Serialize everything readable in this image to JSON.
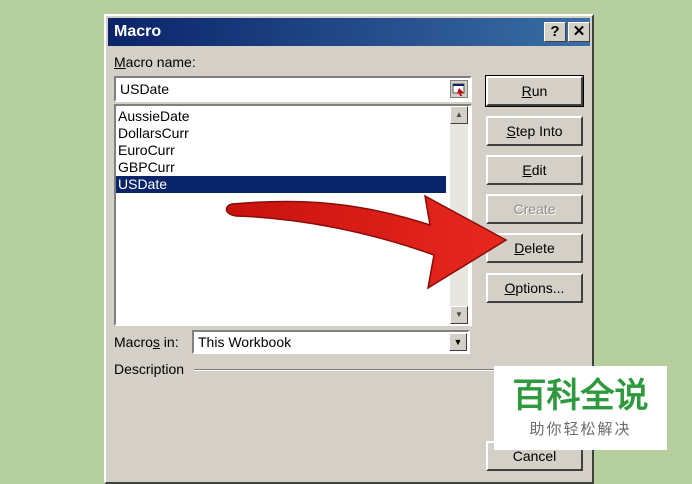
{
  "window": {
    "title": "Macro",
    "help_button": "?",
    "close_button": "✕"
  },
  "macro_name": {
    "label": "Macro name:",
    "value": "USDate"
  },
  "macro_list": {
    "items": [
      "AussieDate",
      "DollarsCurr",
      "EuroCurr",
      "GBPCurr",
      "USDate"
    ],
    "selected": "USDate"
  },
  "buttons": {
    "run": "Run",
    "step_into": "Step Into",
    "edit": "Edit",
    "create": "Create",
    "delete": "Delete",
    "options": "Options...",
    "cancel": "Cancel"
  },
  "macros_in": {
    "label": "Macros in:",
    "value": "This Workbook"
  },
  "description": {
    "label": "Description"
  },
  "watermark": {
    "main": "百科全说",
    "sub": "助你轻松解决"
  },
  "colors": {
    "arrow": "#e3201a",
    "selection": "#0a246a",
    "watermark_green": "#2f9a3d"
  }
}
